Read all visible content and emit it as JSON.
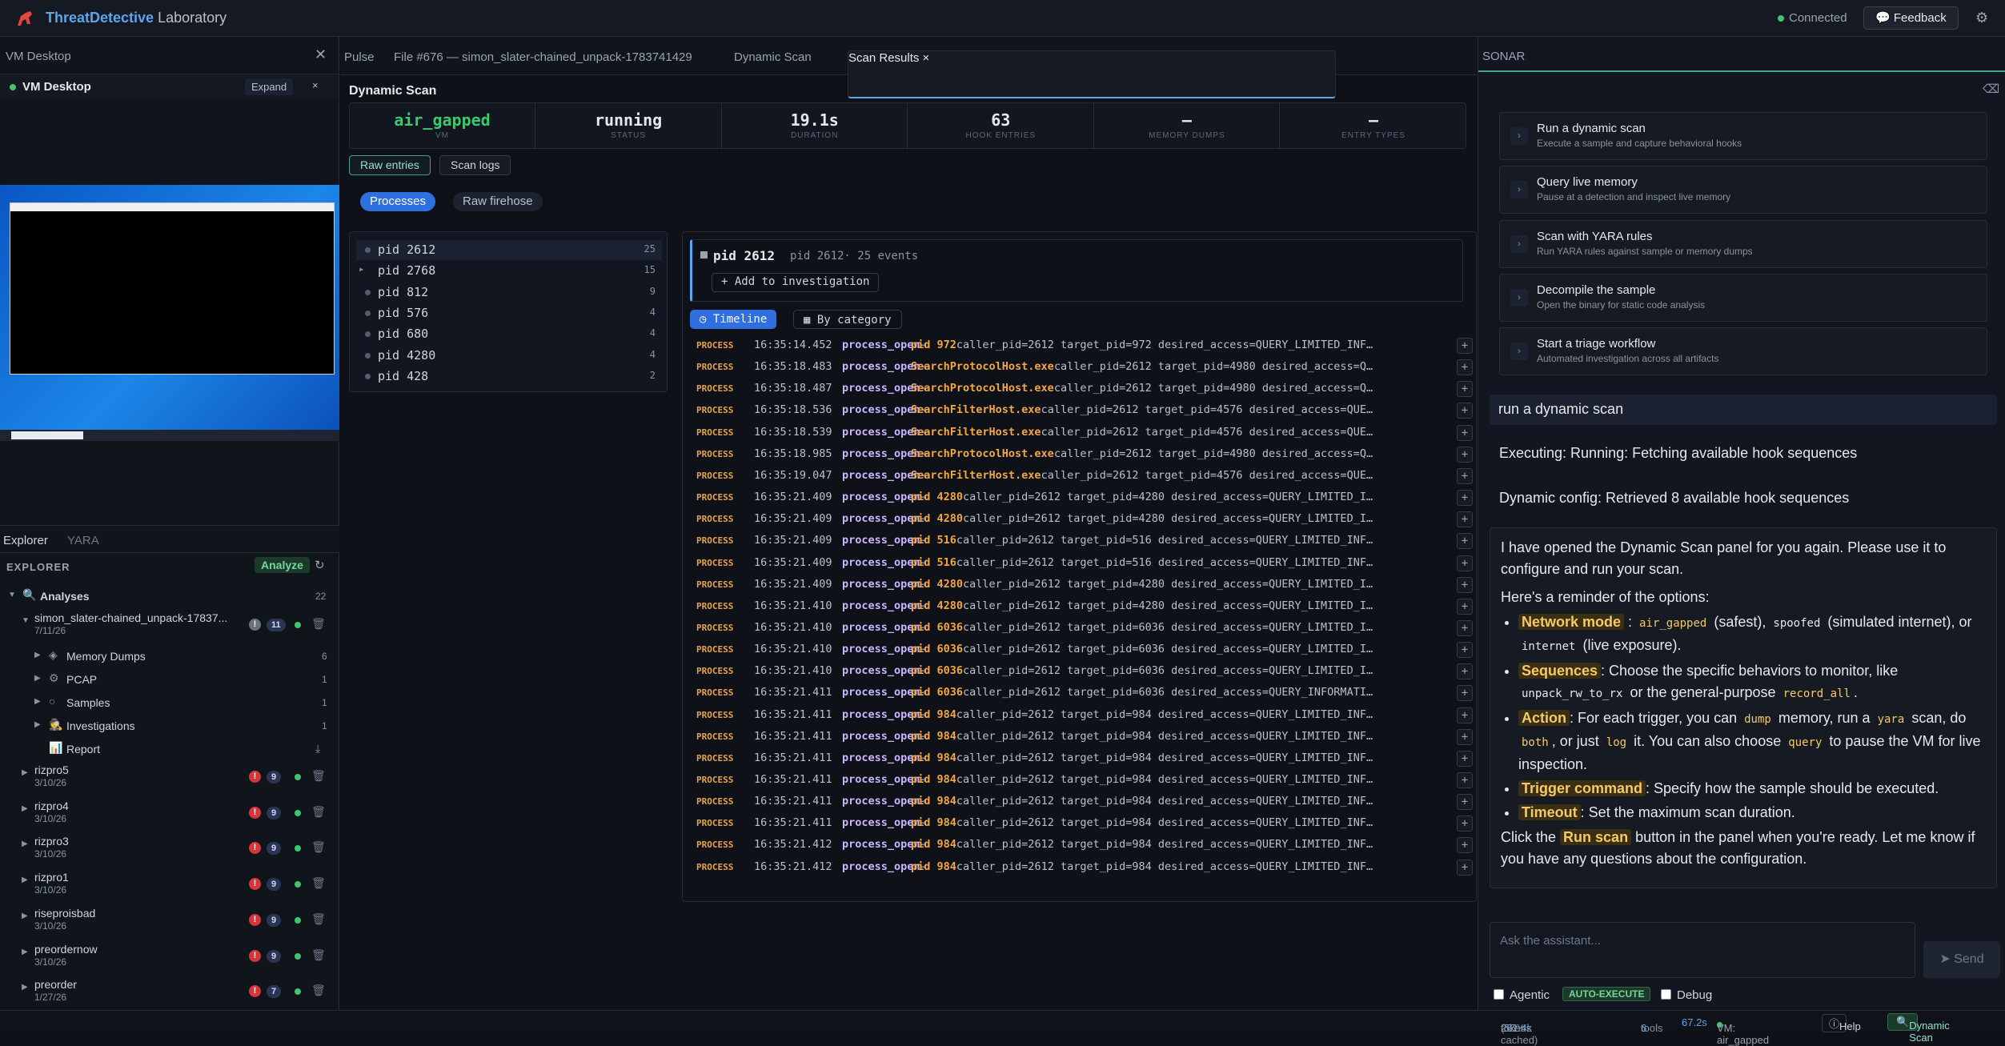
{
  "app": {
    "brand": "ThreatDetective",
    "brand_suffix": "Laboratory",
    "connection": "Connected",
    "feedback": "Feedback"
  },
  "vm": {
    "panel_title": "VM Desktop",
    "sub_title": "VM Desktop",
    "expand": "Expand",
    "close": "×"
  },
  "explorer": {
    "tabs": [
      "Explorer",
      "YARA"
    ],
    "header": "EXPLORER",
    "analyze": "Analyze",
    "analyses_label": "Analyses",
    "analyses_count": "22",
    "current": {
      "name": "simon_slater-chained_unpack-17837...",
      "date": "7/11/26",
      "alert": "!",
      "count": "11"
    },
    "children": [
      {
        "label": "Memory Dumps",
        "count": "6"
      },
      {
        "label": "PCAP",
        "count": "1"
      },
      {
        "label": "Samples",
        "count": "1"
      },
      {
        "label": "Investigations",
        "count": "1"
      },
      {
        "label": "Report",
        "count": ""
      }
    ],
    "items": [
      {
        "name": "rizpro5",
        "date": "3/10/26",
        "count": "9"
      },
      {
        "name": "rizpro4",
        "date": "3/10/26",
        "count": "9"
      },
      {
        "name": "rizpro3",
        "date": "3/10/26",
        "count": "9"
      },
      {
        "name": "rizpro1",
        "date": "3/10/26",
        "count": "9"
      },
      {
        "name": "riseproisbad",
        "date": "3/10/26",
        "count": "9"
      },
      {
        "name": "preordernow",
        "date": "3/10/26",
        "count": "9"
      },
      {
        "name": "preorder",
        "date": "1/27/26",
        "count": "7"
      }
    ]
  },
  "tabs": {
    "pulse": "Pulse",
    "file": "File #676 — simon_slater-chained_unpack-1783741429",
    "dynamic": "Dynamic Scan",
    "results": "Scan Results",
    "close": "×"
  },
  "scan": {
    "title": "Dynamic Scan",
    "stats": [
      {
        "value": "air_gapped",
        "label": "VM"
      },
      {
        "value": "running",
        "label": "STATUS"
      },
      {
        "value": "19.1s",
        "label": "DURATION"
      },
      {
        "value": "63",
        "label": "HOOK ENTRIES"
      },
      {
        "value": "—",
        "label": "MEMORY DUMPS"
      },
      {
        "value": "—",
        "label": "ENTRY TYPES"
      }
    ],
    "view_buttons": [
      "Raw entries",
      "Scan logs"
    ],
    "mode_pills": [
      "Processes",
      "Raw firehose"
    ],
    "processes": [
      {
        "pid": "pid 2612",
        "count": "25",
        "expand": ""
      },
      {
        "pid": "pid 2768",
        "count": "15",
        "expand": "▸"
      },
      {
        "pid": "pid 812",
        "count": "9",
        "expand": ""
      },
      {
        "pid": "pid 576",
        "count": "4",
        "expand": ""
      },
      {
        "pid": "pid 680",
        "count": "4",
        "expand": ""
      },
      {
        "pid": "pid 4280",
        "count": "4",
        "expand": ""
      },
      {
        "pid": "pid 428",
        "count": "2",
        "expand": ""
      }
    ],
    "detail": {
      "pid": "pid 2612",
      "meta": "pid 2612· 25 events",
      "add": "+ Add to investigation",
      "timeline": "Timeline",
      "by_category": "By category"
    },
    "events": [
      {
        "type": "PROCESS",
        "time": "16:35:14.452",
        "op": "process_open",
        "target": "pid 972",
        "args": "caller_pid=2612 target_pid=972 desired_access=QUERY_LIMITED_INF…"
      },
      {
        "type": "PROCESS",
        "time": "16:35:18.483",
        "op": "process_open",
        "target": "SearchProtocolHost.exe",
        "args": "caller_pid=2612 target_pid=4980 desired_access=Q…"
      },
      {
        "type": "PROCESS",
        "time": "16:35:18.487",
        "op": "process_open",
        "target": "SearchProtocolHost.exe",
        "args": "caller_pid=2612 target_pid=4980 desired_access=Q…"
      },
      {
        "type": "PROCESS",
        "time": "16:35:18.536",
        "op": "process_open",
        "target": "SearchFilterHost.exe",
        "args": "caller_pid=2612 target_pid=4576 desired_access=QUE…"
      },
      {
        "type": "PROCESS",
        "time": "16:35:18.539",
        "op": "process_open",
        "target": "SearchFilterHost.exe",
        "args": "caller_pid=2612 target_pid=4576 desired_access=QUE…"
      },
      {
        "type": "PROCESS",
        "time": "16:35:18.985",
        "op": "process_open",
        "target": "SearchProtocolHost.exe",
        "args": "caller_pid=2612 target_pid=4980 desired_access=Q…"
      },
      {
        "type": "PROCESS",
        "time": "16:35:19.047",
        "op": "process_open",
        "target": "SearchFilterHost.exe",
        "args": "caller_pid=2612 target_pid=4576 desired_access=QUE…"
      },
      {
        "type": "PROCESS",
        "time": "16:35:21.409",
        "op": "process_open",
        "target": "pid 4280",
        "args": "caller_pid=2612 target_pid=4280 desired_access=QUERY_LIMITED_I…"
      },
      {
        "type": "PROCESS",
        "time": "16:35:21.409",
        "op": "process_open",
        "target": "pid 4280",
        "args": "caller_pid=2612 target_pid=4280 desired_access=QUERY_LIMITED_I…"
      },
      {
        "type": "PROCESS",
        "time": "16:35:21.409",
        "op": "process_open",
        "target": "pid 516",
        "args": "caller_pid=2612 target_pid=516 desired_access=QUERY_LIMITED_INF…"
      },
      {
        "type": "PROCESS",
        "time": "16:35:21.409",
        "op": "process_open",
        "target": "pid 516",
        "args": "caller_pid=2612 target_pid=516 desired_access=QUERY_LIMITED_INF…"
      },
      {
        "type": "PROCESS",
        "time": "16:35:21.409",
        "op": "process_open",
        "target": "pid 4280",
        "args": "caller_pid=2612 target_pid=4280 desired_access=QUERY_LIMITED_I…"
      },
      {
        "type": "PROCESS",
        "time": "16:35:21.410",
        "op": "process_open",
        "target": "pid 4280",
        "args": "caller_pid=2612 target_pid=4280 desired_access=QUERY_LIMITED_I…"
      },
      {
        "type": "PROCESS",
        "time": "16:35:21.410",
        "op": "process_open",
        "target": "pid 6036",
        "args": "caller_pid=2612 target_pid=6036 desired_access=QUERY_LIMITED_I…"
      },
      {
        "type": "PROCESS",
        "time": "16:35:21.410",
        "op": "process_open",
        "target": "pid 6036",
        "args": "caller_pid=2612 target_pid=6036 desired_access=QUERY_LIMITED_I…"
      },
      {
        "type": "PROCESS",
        "time": "16:35:21.410",
        "op": "process_open",
        "target": "pid 6036",
        "args": "caller_pid=2612 target_pid=6036 desired_access=QUERY_LIMITED_I…"
      },
      {
        "type": "PROCESS",
        "time": "16:35:21.411",
        "op": "process_open",
        "target": "pid 6036",
        "args": "caller_pid=2612 target_pid=6036 desired_access=QUERY_INFORMATI…"
      },
      {
        "type": "PROCESS",
        "time": "16:35:21.411",
        "op": "process_open",
        "target": "pid 984",
        "args": "caller_pid=2612 target_pid=984 desired_access=QUERY_LIMITED_INF…"
      },
      {
        "type": "PROCESS",
        "time": "16:35:21.411",
        "op": "process_open",
        "target": "pid 984",
        "args": "caller_pid=2612 target_pid=984 desired_access=QUERY_LIMITED_INF…"
      },
      {
        "type": "PROCESS",
        "time": "16:35:21.411",
        "op": "process_open",
        "target": "pid 984",
        "args": "caller_pid=2612 target_pid=984 desired_access=QUERY_LIMITED_INF…"
      },
      {
        "type": "PROCESS",
        "time": "16:35:21.411",
        "op": "process_open",
        "target": "pid 984",
        "args": "caller_pid=2612 target_pid=984 desired_access=QUERY_LIMITED_INF…"
      },
      {
        "type": "PROCESS",
        "time": "16:35:21.411",
        "op": "process_open",
        "target": "pid 984",
        "args": "caller_pid=2612 target_pid=984 desired_access=QUERY_LIMITED_INF…"
      },
      {
        "type": "PROCESS",
        "time": "16:35:21.411",
        "op": "process_open",
        "target": "pid 984",
        "args": "caller_pid=2612 target_pid=984 desired_access=QUERY_LIMITED_INF…"
      },
      {
        "type": "PROCESS",
        "time": "16:35:21.412",
        "op": "process_open",
        "target": "pid 984",
        "args": "caller_pid=2612 target_pid=984 desired_access=QUERY_LIMITED_INF…"
      },
      {
        "type": "PROCESS",
        "time": "16:35:21.412",
        "op": "process_open",
        "target": "pid 984",
        "args": "caller_pid=2612 target_pid=984 desired_access=QUERY_LIMITED_INF…"
      }
    ]
  },
  "sonar": {
    "title": "SONAR",
    "actions": [
      {
        "title": "Run a dynamic scan",
        "desc": "Execute a sample and capture behavioral hooks"
      },
      {
        "title": "Query live memory",
        "desc": "Pause at a detection and inspect live memory"
      },
      {
        "title": "Scan with YARA rules",
        "desc": "Run YARA rules against sample or memory dumps"
      },
      {
        "title": "Decompile the sample",
        "desc": "Open the binary for static code analysis"
      },
      {
        "title": "Start a triage workflow",
        "desc": "Automated investigation across all artifacts"
      }
    ],
    "user_msg": "run a dynamic scan",
    "sys1": "Executing: Running: Fetching available hook sequences",
    "sys2": "Dynamic config: Retrieved 8 available hook sequences",
    "reply": {
      "p1": "I have opened the Dynamic Scan panel for you again. Please use it to configure and run your scan.",
      "p2": "Here's a reminder of the options:",
      "network": "Network mode",
      "air": "air_gapped",
      "safest": "(safest),",
      "spoofed": "spoofed",
      "sim": "(simulated internet), or",
      "internet": "internet",
      "live": "(live exposure).",
      "sequences": "Sequences",
      "seq_text": ": Choose the specific behaviors to monitor, like",
      "unpack": "unpack_rw_to_rx",
      "gp": "or the general-purpose",
      "record": "record_all",
      "dot": ".",
      "action": "Action",
      "act1": ": For each trigger, you can",
      "dump": "dump",
      "act2": "memory, run a",
      "yara": "yara",
      "act3": "scan, do",
      "both": "both",
      "act4": ", or just",
      "log": "log",
      "act5": "it. You can also choose",
      "query": "query",
      "act6": "to pause the VM for live inspection.",
      "trigger": "Trigger command",
      "trig_text": ": Specify how the sample should be executed.",
      "timeout": "Timeout",
      "to_text": ": Set the maximum scan duration.",
      "click": "Click the",
      "runscan": "Run scan",
      "end": "button in the panel when you're ready. Let me know if you have any questions about the configuration."
    },
    "ask_placeholder": "Ask the assistant...",
    "send": "Send",
    "agentic": "Agentic",
    "auto": "AUTO-EXECUTE",
    "debug": "Debug"
  },
  "status": {
    "tokens": "261.4k",
    "tokens_label": "tokens",
    "cached": "(55% cached)",
    "tools": "6",
    "tools_label": "tools",
    "time": "67.2s",
    "vm": "VM: air_gapped",
    "help": "Help",
    "dynamic": "Dynamic Scan"
  },
  "colors": {
    "accent": "#5aa6f0",
    "green": "#3fc76d",
    "event_type": "#e5a34a",
    "op": "#c9b6ff",
    "target": "#f2a742"
  }
}
